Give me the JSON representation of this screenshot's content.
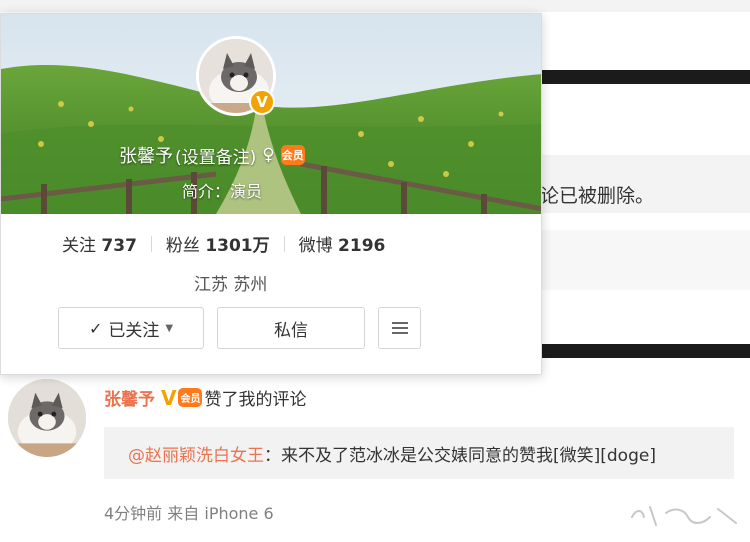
{
  "feed": {
    "deleted_notice": "论已被删除。"
  },
  "profile_card": {
    "name": "张馨予",
    "remark_link": "(设置备注)",
    "member_badge": "会员",
    "intro": "简介：演员",
    "stats": [
      {
        "label": "关注",
        "value": "737"
      },
      {
        "label": "粉丝",
        "value": "1301万"
      },
      {
        "label": "微博",
        "value": "2196"
      }
    ],
    "location": "江苏 苏州",
    "buttons": {
      "follow": "已关注",
      "message": "私信"
    },
    "verified_badge": "V",
    "colors": {
      "verified": "#f2a300",
      "accent_name": "#eb7350"
    }
  },
  "notification": {
    "user": "张馨予",
    "verified_mark": "V",
    "member_badge": "会员",
    "action": "赞了我的评论",
    "quoted_user": "@赵丽颖洗白女王",
    "quoted_text": "：来不及了范冰冰是公交婊同意的赞我[微笑][doge]",
    "time": "4分钟前",
    "source": "来自 iPhone 6"
  },
  "icons": [
    "check-icon",
    "caret-down-icon",
    "menu-icon",
    "gender-icon",
    "verified-icon",
    "member-icon"
  ]
}
